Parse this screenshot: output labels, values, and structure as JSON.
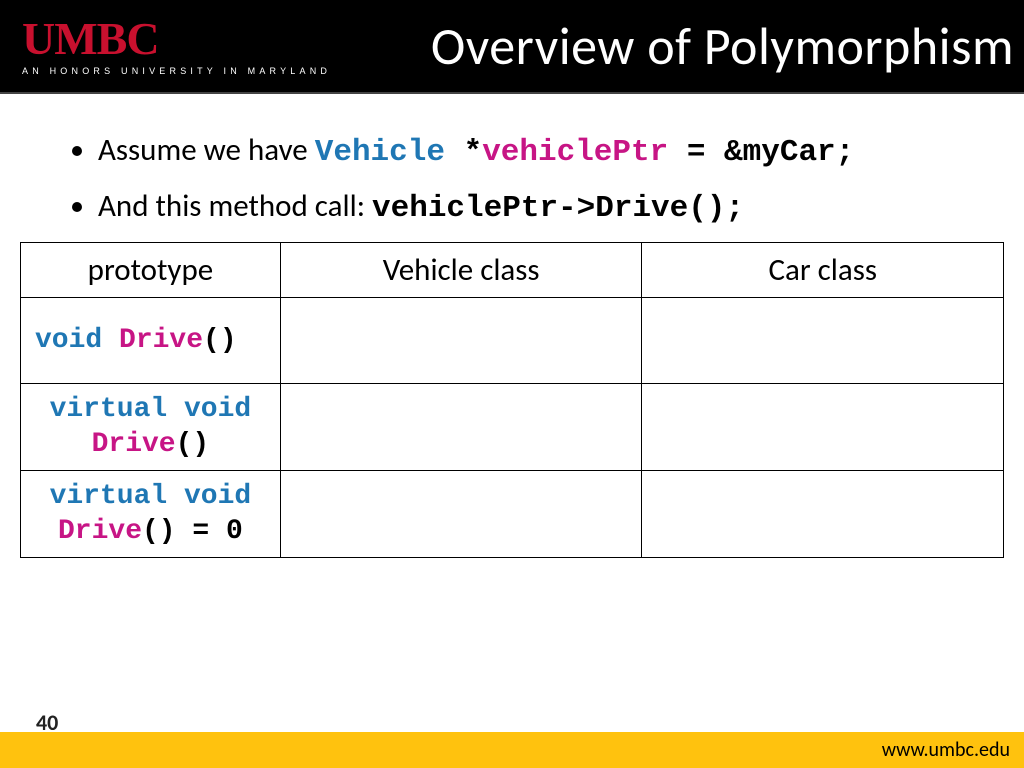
{
  "header": {
    "logo_main": "UMBC",
    "logo_sub": "AN HONORS UNIVERSITY IN MARYLAND",
    "title": "Overview of Polymorphism"
  },
  "bullets": {
    "b1_pre": "Assume we have  ",
    "b1_code": {
      "type": "Vehicle ",
      "star": "*",
      "name": "vehiclePtr",
      "rest": " = &myCar;"
    },
    "b2_pre": "And this method call:   ",
    "b2_code": "vehiclePtr->Drive();"
  },
  "table": {
    "head": {
      "c1": "prototype",
      "c2": "Vehicle class",
      "c3": "Car class"
    },
    "rows": [
      {
        "kw1": "void ",
        "name": "Drive",
        "paren": "()",
        "extra": ""
      },
      {
        "kw1": "virtual void",
        "br": true,
        "name": "Drive",
        "paren": "()",
        "extra": ""
      },
      {
        "kw1": "virtual void",
        "br": true,
        "name": "Drive",
        "paren": "()",
        "extra": " = 0"
      }
    ]
  },
  "footer": {
    "slide_num": "40",
    "url": "www.umbc.edu"
  }
}
